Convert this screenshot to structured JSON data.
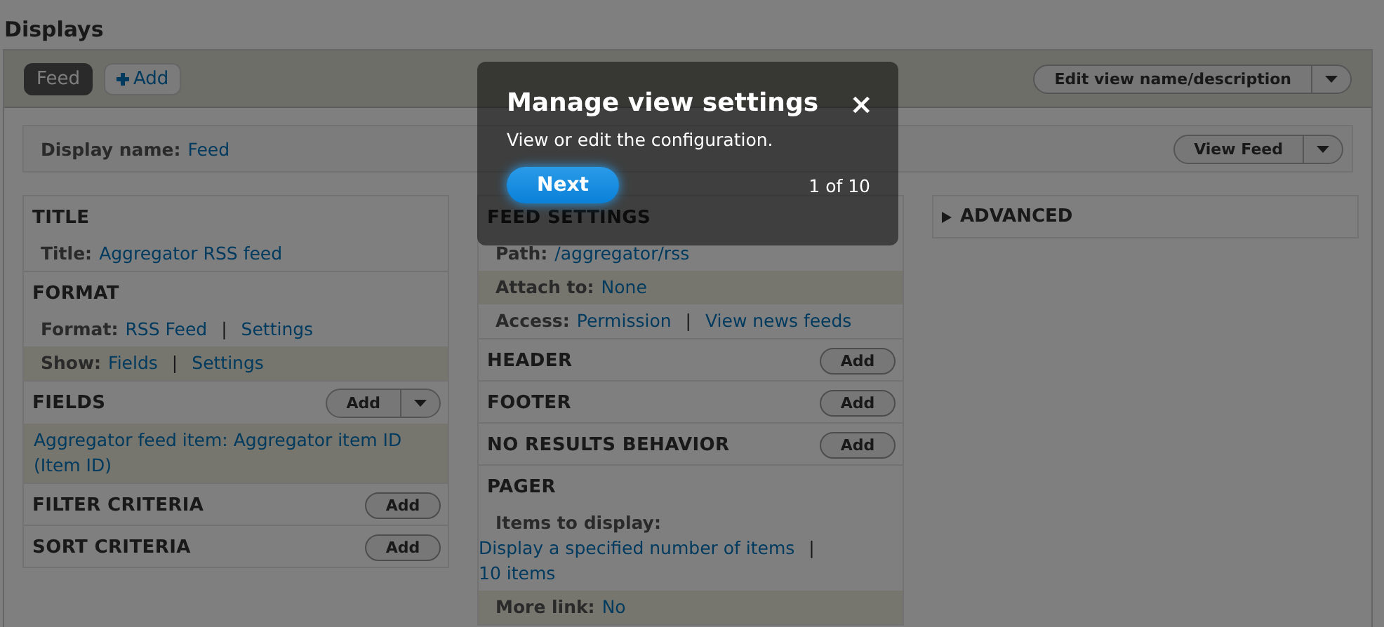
{
  "section_title": "Displays",
  "display_tabs": [
    {
      "label": "Feed",
      "selected": true
    }
  ],
  "add_display": {
    "label": "Add"
  },
  "edit_view_button": {
    "label": "Edit view name/description",
    "dropdown": true
  },
  "display_name": {
    "label": "Display name:",
    "value": "Feed"
  },
  "view_button": {
    "label": "View Feed",
    "dropdown": true
  },
  "columns": [
    {
      "sections": [
        {
          "title": "TITLE",
          "rows": [
            {
              "kind": "inline",
              "label": "Title:",
              "parts": [
                {
                  "kind": "link",
                  "text": "Aggregator RSS feed"
                }
              ],
              "highlighted": false
            }
          ]
        },
        {
          "title": "FORMAT",
          "rows": [
            {
              "kind": "inline",
              "label": "Format:",
              "parts": [
                {
                  "kind": "link",
                  "text": "RSS Feed"
                },
                {
                  "kind": "separator",
                  "text": "|"
                },
                {
                  "kind": "link",
                  "text": "Settings"
                }
              ],
              "highlighted": false
            },
            {
              "kind": "inline",
              "label": "Show:",
              "parts": [
                {
                  "kind": "link",
                  "text": "Fields"
                },
                {
                  "kind": "separator",
                  "text": "|"
                },
                {
                  "kind": "link",
                  "text": "Settings"
                }
              ],
              "highlighted": true
            }
          ]
        },
        {
          "title": "FIELDS",
          "add_button": {
            "label": "Add",
            "dropdown": true
          },
          "rows": [
            {
              "kind": "item",
              "parts": [
                {
                  "kind": "link",
                  "text": "Aggregator feed item: Aggregator item ID (Item ID)"
                }
              ],
              "highlighted": true
            }
          ]
        },
        {
          "title": "FILTER CRITERIA",
          "add_button": {
            "label": "Add",
            "dropdown": false
          }
        },
        {
          "title": "SORT CRITERIA",
          "add_button": {
            "label": "Add",
            "dropdown": false
          }
        }
      ]
    },
    {
      "sections": [
        {
          "title": "FEED SETTINGS",
          "rows": [
            {
              "kind": "inline",
              "label": "Path:",
              "parts": [
                {
                  "kind": "link",
                  "text": "/aggregator/rss"
                }
              ],
              "highlighted": false
            },
            {
              "kind": "inline",
              "label": "Attach to:",
              "parts": [
                {
                  "kind": "link",
                  "text": "None"
                }
              ],
              "highlighted": true
            },
            {
              "kind": "inline",
              "label": "Access:",
              "parts": [
                {
                  "kind": "link",
                  "text": "Permission"
                },
                {
                  "kind": "separator",
                  "text": "|"
                },
                {
                  "kind": "link",
                  "text": "View news feeds"
                }
              ],
              "highlighted": false
            }
          ]
        },
        {
          "title": "HEADER",
          "add_button": {
            "label": "Add",
            "dropdown": false
          }
        },
        {
          "title": "FOOTER",
          "add_button": {
            "label": "Add",
            "dropdown": false
          }
        },
        {
          "title": "NO RESULTS BEHAVIOR",
          "add_button": {
            "label": "Add",
            "dropdown": false
          }
        },
        {
          "title": "PAGER",
          "rows": [
            {
              "kind": "stacked",
              "label": "Items to display:",
              "parts": [
                {
                  "kind": "link",
                  "text": "Display a specified number of items"
                },
                {
                  "kind": "separator",
                  "text": "|"
                },
                {
                  "kind": "link",
                  "text": "10 items"
                }
              ],
              "highlighted": false
            },
            {
              "kind": "inline",
              "label": "More link:",
              "parts": [
                {
                  "kind": "link",
                  "text": "No"
                }
              ],
              "highlighted": true
            }
          ]
        }
      ]
    },
    {
      "collapsible": {
        "title": "ADVANCED",
        "expanded": false
      }
    }
  ],
  "tour": {
    "title": "Manage view settings",
    "body": "View or edit the configuration.",
    "next_button": "Next",
    "counter": "1 of 10",
    "close": "×"
  }
}
